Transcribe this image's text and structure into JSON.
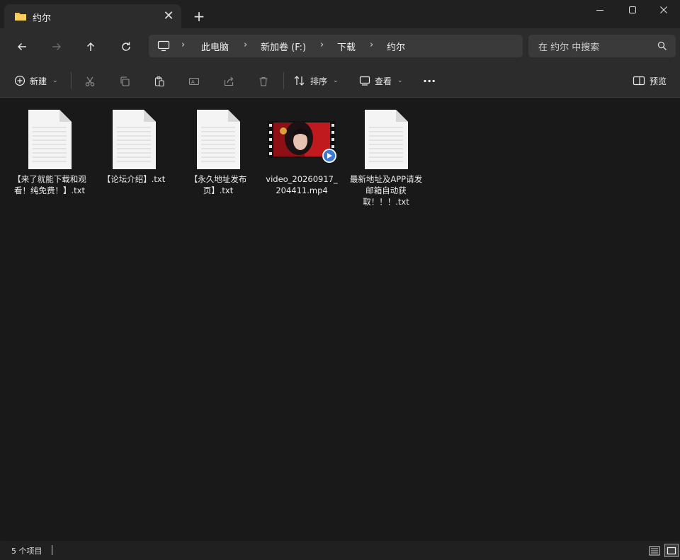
{
  "window": {
    "tab_title": "约尔",
    "tab_close": "✕",
    "new_tab": "+"
  },
  "breadcrumb": {
    "items": [
      "此电脑",
      "新加卷 (F:)",
      "下载",
      "约尔"
    ]
  },
  "search": {
    "placeholder": "在 约尔 中搜索"
  },
  "toolbar": {
    "new_label": "新建",
    "sort_label": "排序",
    "view_label": "查看",
    "more_label": "···",
    "preview_label": "预览"
  },
  "files": [
    {
      "name": "【来了就能下载和观看！纯免费！】.txt",
      "type": "txt"
    },
    {
      "name": "【论坛介绍】.txt",
      "type": "txt"
    },
    {
      "name": "【永久地址发布页】.txt",
      "type": "txt"
    },
    {
      "name": "video_20260917_204411.mp4",
      "type": "mp4"
    },
    {
      "name": "最新地址及APP请发邮箱自动获取！！！.txt",
      "type": "txt"
    }
  ],
  "status": {
    "item_count": "5 个项目"
  },
  "colors": {
    "folder": "#f2c14e",
    "background": "#191919",
    "bar": "#2c2c2c",
    "video_badge": "#3a7bd5"
  }
}
